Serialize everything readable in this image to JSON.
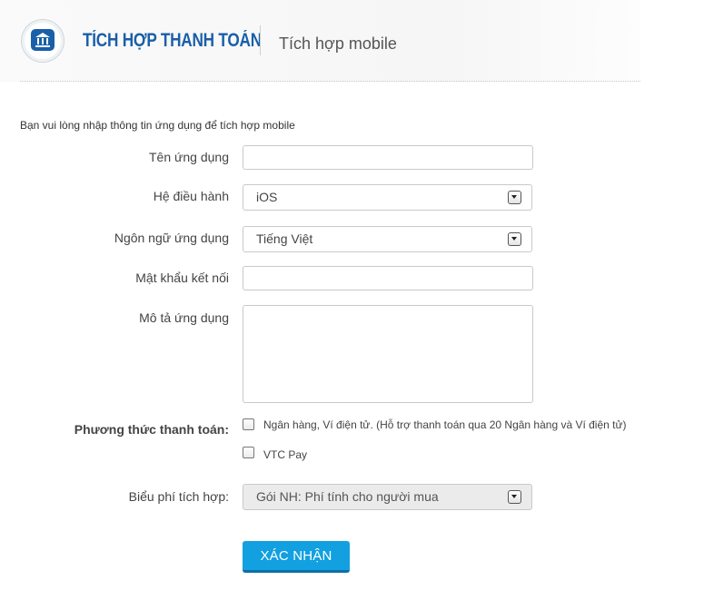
{
  "header": {
    "title": "TÍCH HỢP THANH TOÁN",
    "subtitle": "Tích hợp mobile",
    "logo_icon": "bank-icon"
  },
  "form": {
    "intro": "Bạn vui lòng nhập thông tin ứng dụng để tích hợp mobile",
    "app_name": {
      "label": "Tên ứng dụng",
      "value": ""
    },
    "os": {
      "label": "Hệ điều hành",
      "value": "iOS"
    },
    "language": {
      "label": "Ngôn ngữ ứng dụng",
      "value": "Tiếng Việt"
    },
    "password": {
      "label": "Mật khẩu kết nối",
      "value": ""
    },
    "description": {
      "label": "Mô tả ứng dụng",
      "value": ""
    },
    "payment": {
      "label": "Phương thức thanh toán:",
      "options": [
        {
          "label": "Ngân hàng, Ví điện tử. (Hỗ trợ thanh toán qua 20 Ngân hàng và Ví điện tử)",
          "checked": false
        },
        {
          "label": "VTC Pay",
          "checked": false
        }
      ]
    },
    "fee": {
      "label": "Biểu phí tích hợp:",
      "value": "Gói NH: Phí tính cho người mua"
    },
    "submit_label": "XÁC NHẬN"
  },
  "colors": {
    "brand": "#1a5fa8",
    "button": "#12a0e0"
  }
}
